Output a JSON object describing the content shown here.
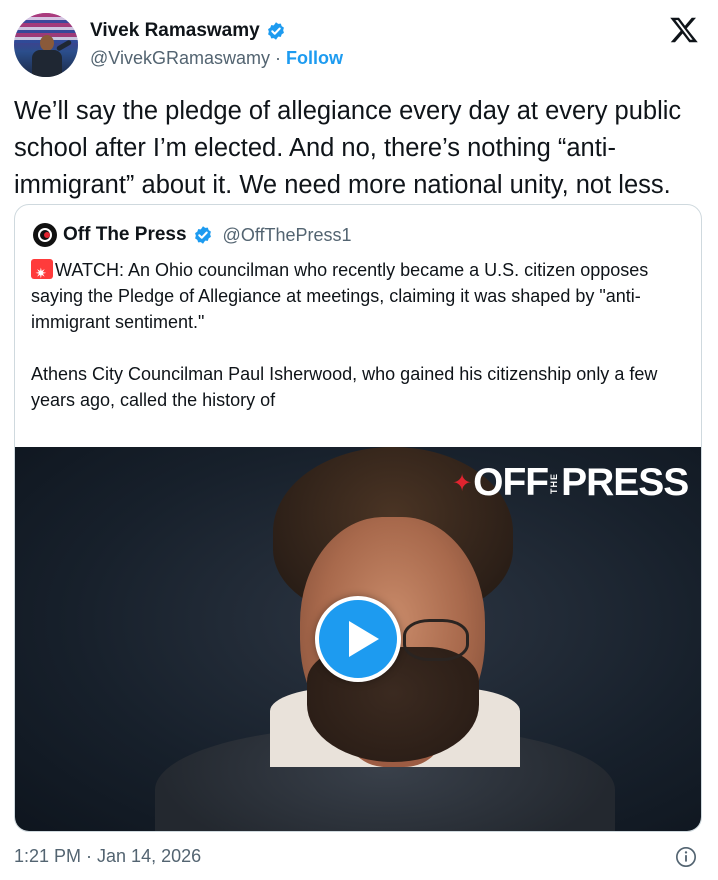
{
  "author": {
    "name": "Vivek Ramaswamy",
    "handle": "@VivekGRamaswamy",
    "separator": "·",
    "follow_label": "Follow",
    "verified": true
  },
  "tweet": {
    "text": "We’ll say the pledge of allegiance every day at every public school after I’m elected. And no, there’s nothing “anti-immigrant” about it. We need more national unity, not less."
  },
  "quoted_tweet": {
    "name": "Off The Press",
    "handle": "@OffThePress1",
    "verified": true,
    "text_line1": "WATCH: An Ohio councilman who recently became a U.S. citizen opposes saying the Pledge of Allegiance at meetings, claiming it was shaped by \"anti-immigrant sentiment.\"",
    "text_line2": "Athens City Councilman Paul Isherwood, who gained his citizenship only a few years ago, called the history of",
    "video": {
      "logo_left": "OFF",
      "logo_the": "THE",
      "logo_right": "PRESS"
    }
  },
  "footer": {
    "timestamp": "1:21 PM · Jan 14, 2026"
  },
  "colors": {
    "accent": "#1d9bf0",
    "text": "#0f1419",
    "secondary": "#536471",
    "border": "#cfd9de"
  },
  "icons": [
    "x-logo-icon",
    "verified-badge-icon",
    "siren-emoji-icon",
    "play-icon",
    "info-icon"
  ]
}
